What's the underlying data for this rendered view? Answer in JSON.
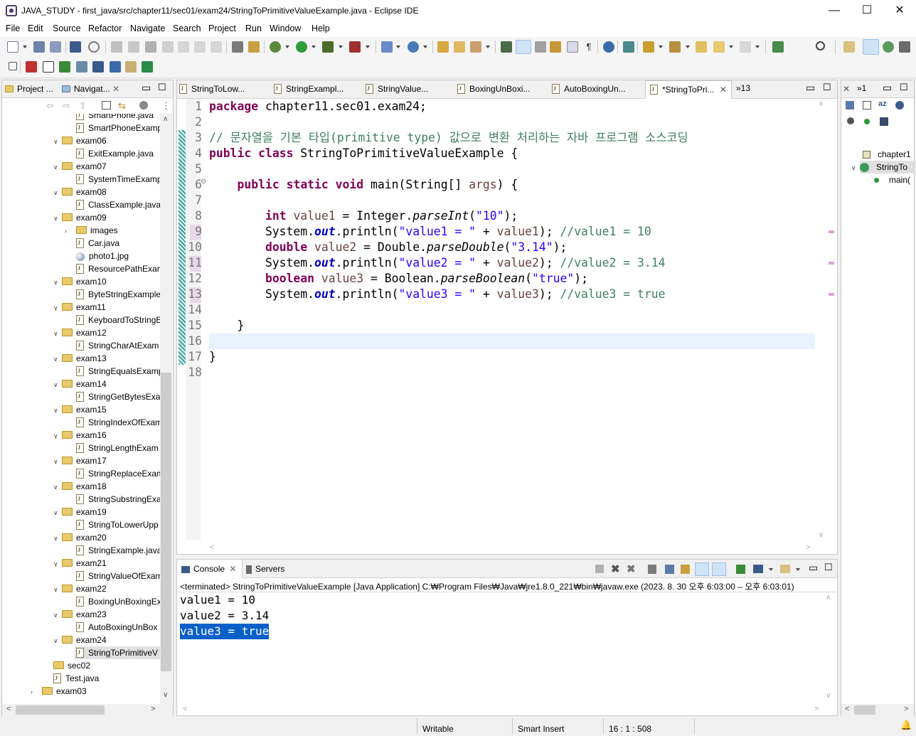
{
  "window": {
    "title": "JAVA_STUDY - first_java/src/chapter11/sec01/exam24/StringToPrimitiveValueExample.java - Eclipse IDE",
    "minimize": "—",
    "maximize": "☐",
    "close": "✕"
  },
  "menu": [
    "File",
    "Edit",
    "Source",
    "Refactor",
    "Navigate",
    "Search",
    "Project",
    "Run",
    "Window",
    "Help"
  ],
  "left_panel": {
    "tabs": [
      "Project ...",
      "Navigat..."
    ],
    "tree": [
      {
        "type": "file",
        "label": "SmartPhone.java",
        "indent": 1
      },
      {
        "type": "file",
        "label": "SmartPhoneExamp",
        "indent": 1
      },
      {
        "type": "folder",
        "label": "exam06",
        "indent": 0
      },
      {
        "type": "file",
        "label": "ExitExample.java",
        "indent": 1
      },
      {
        "type": "folder",
        "label": "exam07",
        "indent": 0
      },
      {
        "type": "file",
        "label": "SystemTimeExamp",
        "indent": 1
      },
      {
        "type": "folder",
        "label": "exam08",
        "indent": 0
      },
      {
        "type": "file",
        "label": "ClassExample.java",
        "indent": 1
      },
      {
        "type": "folder",
        "label": "exam09",
        "indent": 0
      },
      {
        "type": "subfolder",
        "label": "images",
        "indent": 1
      },
      {
        "type": "file",
        "label": "Car.java",
        "indent": 1
      },
      {
        "type": "image",
        "label": "photo1.jpg",
        "indent": 1
      },
      {
        "type": "file",
        "label": "ResourcePathExam",
        "indent": 1
      },
      {
        "type": "folder",
        "label": "exam10",
        "indent": 0
      },
      {
        "type": "file",
        "label": "ByteStringExample",
        "indent": 1
      },
      {
        "type": "folder",
        "label": "exam11",
        "indent": 0
      },
      {
        "type": "file",
        "label": "KeyboardToStringE",
        "indent": 1
      },
      {
        "type": "folder",
        "label": "exam12",
        "indent": 0
      },
      {
        "type": "file",
        "label": "StringCharAtExam",
        "indent": 1
      },
      {
        "type": "folder",
        "label": "exam13",
        "indent": 0
      },
      {
        "type": "file",
        "label": "StringEqualsExamp",
        "indent": 1
      },
      {
        "type": "folder",
        "label": "exam14",
        "indent": 0
      },
      {
        "type": "file",
        "label": "StringGetBytesExan",
        "indent": 1
      },
      {
        "type": "folder",
        "label": "exam15",
        "indent": 0
      },
      {
        "type": "file",
        "label": "StringIndexOfExam",
        "indent": 1
      },
      {
        "type": "folder",
        "label": "exam16",
        "indent": 0
      },
      {
        "type": "file",
        "label": "StringLengthExam",
        "indent": 1
      },
      {
        "type": "folder",
        "label": "exam17",
        "indent": 0
      },
      {
        "type": "file",
        "label": "StringReplaceExam",
        "indent": 1
      },
      {
        "type": "folder",
        "label": "exam18",
        "indent": 0
      },
      {
        "type": "file",
        "label": "StringSubstringExa",
        "indent": 1
      },
      {
        "type": "folder",
        "label": "exam19",
        "indent": 0
      },
      {
        "type": "file",
        "label": "StringToLowerUpp",
        "indent": 1
      },
      {
        "type": "folder",
        "label": "exam20",
        "indent": 0
      },
      {
        "type": "file",
        "label": "StringExample.java",
        "indent": 1
      },
      {
        "type": "folder",
        "label": "exam21",
        "indent": 0
      },
      {
        "type": "file",
        "label": "StringValueOfExam",
        "indent": 1
      },
      {
        "type": "folder",
        "label": "exam22",
        "indent": 0
      },
      {
        "type": "file",
        "label": "BoxingUnBoxingEx",
        "indent": 1
      },
      {
        "type": "folder",
        "label": "exam23",
        "indent": 0
      },
      {
        "type": "file",
        "label": "AutoBoxingUnBox",
        "indent": 1
      },
      {
        "type": "folder",
        "label": "exam24",
        "indent": 0
      },
      {
        "type": "file",
        "label": "StringToPrimitiveV",
        "indent": 1,
        "selected": true
      },
      {
        "type": "pkg",
        "label": "sec02",
        "indent": -1
      },
      {
        "type": "file",
        "label": "Test.java",
        "indent": -1
      },
      {
        "type": "collapsed",
        "label": "exam03",
        "indent": -2
      }
    ]
  },
  "editor": {
    "tabs": [
      "StringToLow...",
      "StringExampl...",
      "StringValue...",
      "BoxingUnBoxi...",
      "AutoBoxingUn...",
      "*StringToPri..."
    ],
    "overflow": "»13",
    "line_numbers": [
      "1",
      "2",
      "3",
      "4",
      "5",
      "6",
      "7",
      "8",
      "9",
      "10",
      "11",
      "12",
      "13",
      "14",
      "15",
      "16",
      "17",
      "18"
    ]
  },
  "right_panel": {
    "overflow": "»1",
    "outline": [
      "chapter1",
      "StringTo",
      "main("
    ]
  },
  "console": {
    "tabs": [
      "Console",
      "Servers"
    ],
    "status_line": "<terminated> StringToPrimitiveValueExample [Java Application] C:₩Program Files₩Java₩jre1.8.0_221₩bin₩javaw.exe  (2023. 8. 30 오후 6:03:00 – 오후 6:03:01)",
    "output": [
      "value1 = 10",
      "value2 = 3.14",
      "value3 = true"
    ]
  },
  "status_bar": {
    "writable": "Writable",
    "insert_mode": "Smart Insert",
    "position": "16 : 1 : 508"
  }
}
